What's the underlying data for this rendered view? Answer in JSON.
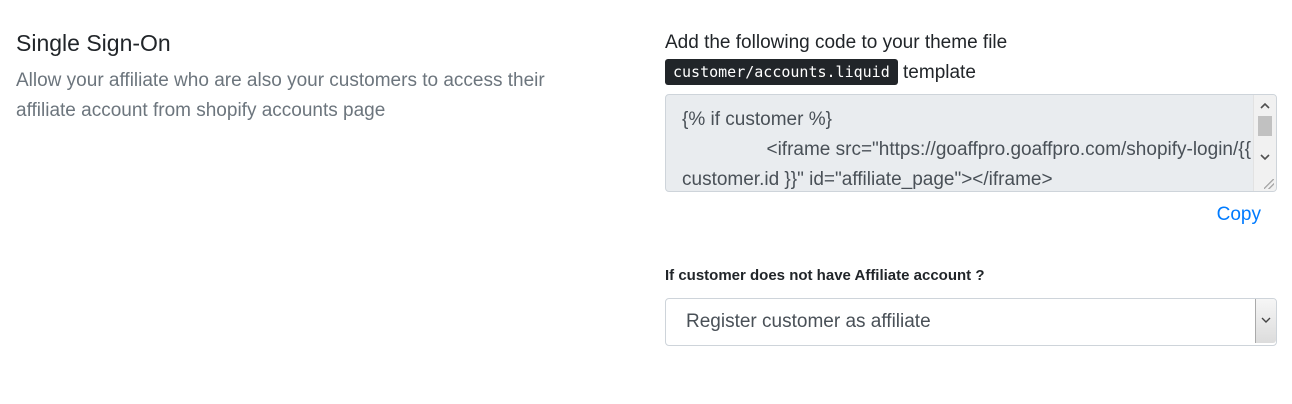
{
  "left": {
    "title": "Single Sign-On",
    "description": "Allow your affiliate who are also your customers to access their affiliate account from shopify accounts page"
  },
  "right": {
    "instruction_prefix": "Add the following code to your theme file",
    "template_file": "customer/accounts.liquid",
    "instruction_suffix": "template",
    "code": "{% if customer %}\n\t\t<iframe src=\"https://goaffpro.goaffpro.com/shopify-login/{{ customer.id }}\" id=\"affiliate_page\"></iframe>",
    "copy_label": "Copy",
    "select_label": "If customer does not have Affiliate account ?",
    "select_value": "Register customer as affiliate"
  },
  "icons": {
    "scroll_up": "scroll-up-arrow",
    "scroll_down": "scroll-down-arrow",
    "select_arrow": "chevron-down-icon"
  },
  "colors": {
    "link": "#007bff",
    "code_chip_bg": "#212529",
    "muted_text": "#6c757d"
  }
}
